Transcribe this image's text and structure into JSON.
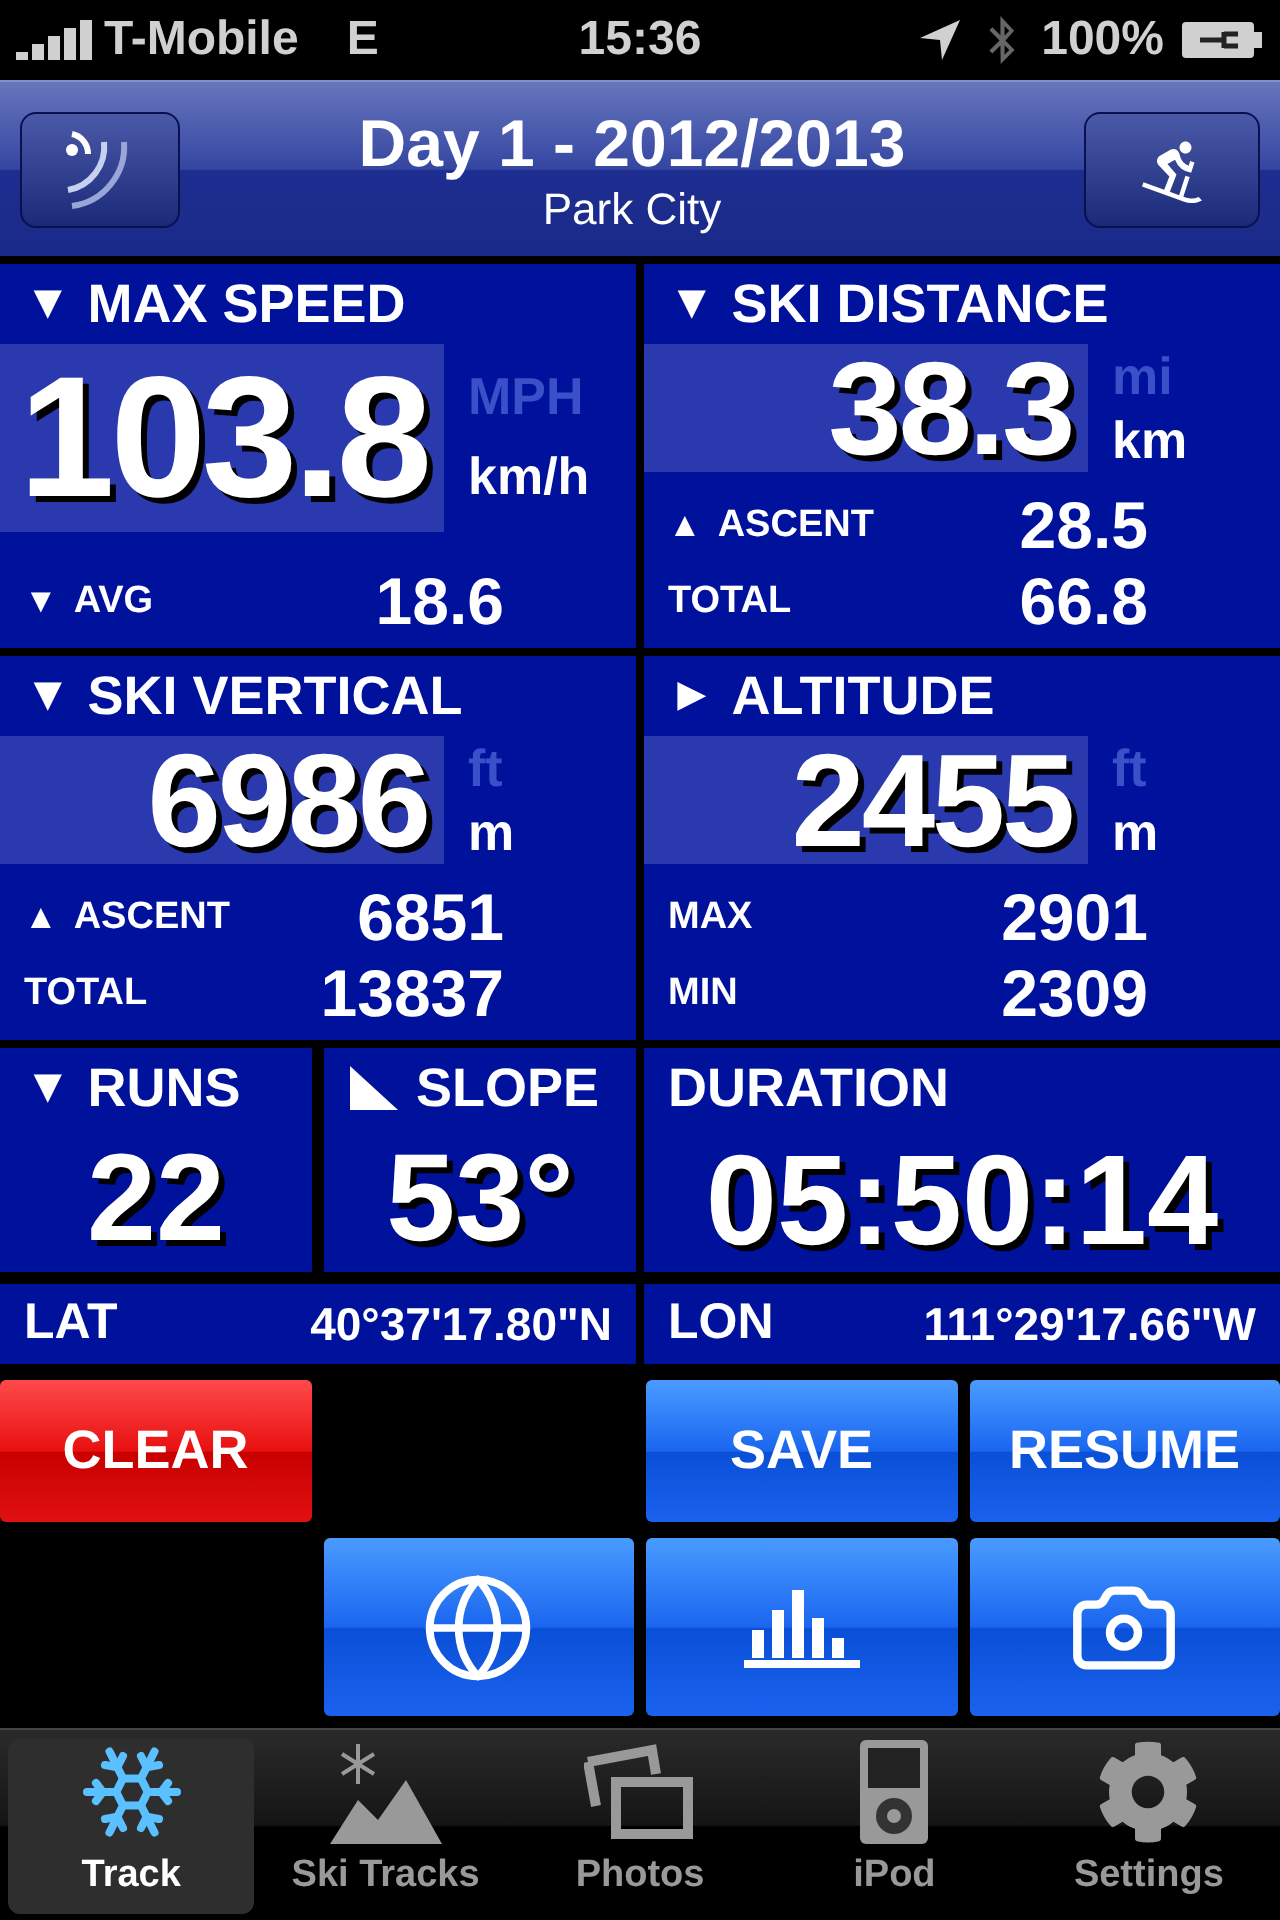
{
  "status_bar": {
    "carrier": "T-Mobile",
    "network": "E",
    "time": "15:36",
    "battery": "100%"
  },
  "nav": {
    "title": "Day 1 - 2012/2013",
    "subtitle": "Park City"
  },
  "panels": [
    {
      "marker": "▼",
      "title": "MAX SPEED",
      "value": "103.8",
      "units": [
        {
          "label": "MPH",
          "selected": false
        },
        {
          "label": "km/h",
          "selected": true
        }
      ],
      "stats": [
        {
          "marker": "▼",
          "label": "AVG",
          "value": "18.6"
        }
      ]
    },
    {
      "marker": "▼",
      "title": "SKI DISTANCE",
      "value": "38.3",
      "units": [
        {
          "label": "mi",
          "selected": false
        },
        {
          "label": "km",
          "selected": true
        }
      ],
      "stats": [
        {
          "marker": "▲",
          "label": "ASCENT",
          "value": "28.5"
        },
        {
          "label": "TOTAL",
          "value": "66.8"
        }
      ]
    },
    {
      "marker": "▼",
      "title": "SKI VERTICAL",
      "value": "6986",
      "units": [
        {
          "label": "ft",
          "selected": false
        },
        {
          "label": "m",
          "selected": true
        }
      ],
      "stats": [
        {
          "marker": "▲",
          "label": "ASCENT",
          "value": "6851"
        },
        {
          "label": "TOTAL",
          "value": "13837"
        }
      ]
    },
    {
      "marker": "►",
      "title": "ALTITUDE",
      "value": "2455",
      "units": [
        {
          "label": "ft",
          "selected": false
        },
        {
          "label": "m",
          "selected": true
        }
      ],
      "stats": [
        {
          "label": "MAX",
          "value": "2901"
        },
        {
          "label": "MIN",
          "value": "2309"
        }
      ]
    }
  ],
  "small_panels": [
    {
      "kind": "runs",
      "marker": "▼",
      "title": "RUNS",
      "value": "22"
    },
    {
      "kind": "slope",
      "title": "SLOPE",
      "value": "53°"
    },
    {
      "kind": "duration",
      "title": "DURATION",
      "value": "05:50:14"
    }
  ],
  "coordinates": [
    {
      "label": "LAT",
      "value": "40°37'17.80\"N"
    },
    {
      "label": "LON",
      "value": "111°29'17.66\"W"
    }
  ],
  "buttons": [
    {
      "kind": "danger",
      "label": "CLEAR"
    },
    {
      "kind": "primary",
      "label": "SAVE"
    },
    {
      "kind": "primary",
      "label": "RESUME"
    }
  ],
  "tabs": [
    {
      "label": "Track",
      "selected": true
    },
    {
      "label": "Ski Tracks",
      "selected": false
    },
    {
      "label": "Photos",
      "selected": false
    },
    {
      "label": "iPod",
      "selected": false
    },
    {
      "label": "Settings",
      "selected": false
    }
  ]
}
